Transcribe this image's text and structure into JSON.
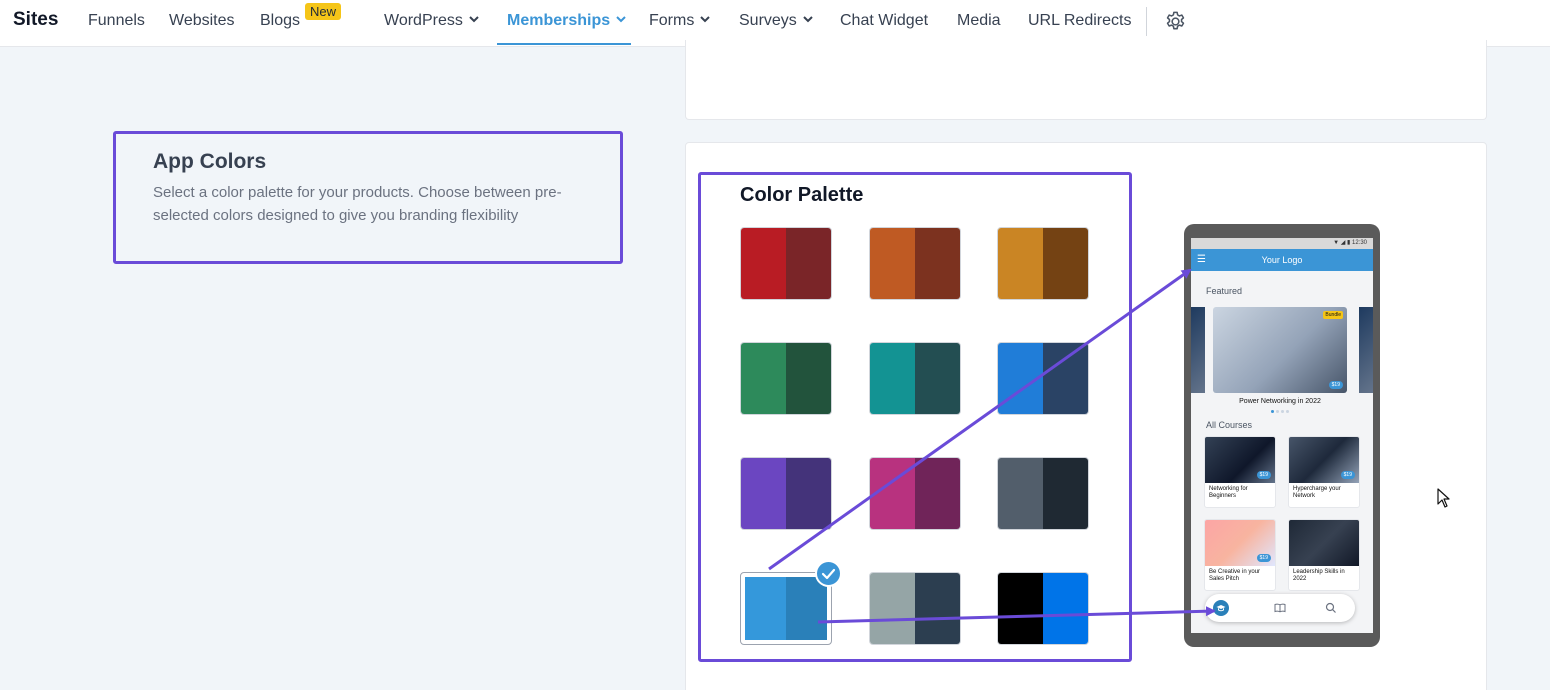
{
  "nav": {
    "brand": "Sites",
    "items": [
      {
        "label": "Funnels"
      },
      {
        "label": "Websites"
      },
      {
        "label": "Blogs"
      },
      {
        "label": "WordPress"
      },
      {
        "label": "Memberships"
      },
      {
        "label": "Forms"
      },
      {
        "label": "Surveys"
      },
      {
        "label": "Chat Widget"
      },
      {
        "label": "Media"
      },
      {
        "label": "URL Redirects"
      }
    ],
    "new_badge": "New",
    "active_item": "Memberships"
  },
  "app_colors": {
    "title": "App Colors",
    "description": "Select a color palette for your products. Choose between pre-selected colors designed to give you branding flexibility"
  },
  "palette": {
    "title": "Color Palette",
    "selected_index": 9,
    "swatches": [
      {
        "primary": "#b91c24",
        "secondary": "#7a2528"
      },
      {
        "primary": "#bf5a23",
        "secondary": "#7c321f"
      },
      {
        "primary": "#ca8524",
        "secondary": "#744213"
      },
      {
        "primary": "#2d8a5b",
        "secondary": "#22533c"
      },
      {
        "primary": "#139393",
        "secondary": "#234e52"
      },
      {
        "primary": "#207dd8",
        "secondary": "#2a4365"
      },
      {
        "primary": "#6b46c1",
        "secondary": "#44337a"
      },
      {
        "primary": "#b8327f",
        "secondary": "#702459"
      },
      {
        "primary": "#525e6b",
        "secondary": "#1f2933"
      },
      {
        "primary": "#3498db",
        "secondary": "#2a80b9"
      },
      {
        "primary": "#95a5a6",
        "secondary": "#2c3e50"
      },
      {
        "primary": "#000000",
        "secondary": "#0074e8"
      }
    ]
  },
  "preview": {
    "status_time": "12:30",
    "app_title": "Your Logo",
    "featured_label": "Featured",
    "bundle_badge": "Bundle",
    "featured_price": "$19",
    "featured_name": "Power Networking in 2022",
    "all_courses_label": "All Courses",
    "courses": [
      {
        "name": "Networking for Beginners",
        "price": "$19"
      },
      {
        "name": "Hypercharge your Network",
        "price": "$19"
      },
      {
        "name": "Be Creative in your Sales Pitch",
        "price": "$19"
      },
      {
        "name": "Leadership Skills in 2022",
        "price": ""
      }
    ]
  },
  "colors": {
    "accent": "#3b95d6",
    "highlight_outline": "#6a4bd8",
    "badge": "#f5c518"
  }
}
